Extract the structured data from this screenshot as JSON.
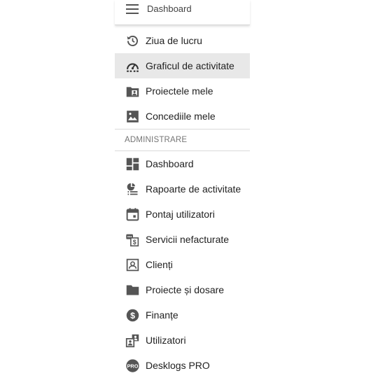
{
  "header": {
    "title": "Dashboard"
  },
  "menu_top": [
    {
      "label": "Ziua de lucru",
      "icon": "history-clock-icon",
      "active": false
    },
    {
      "label": "Graficul de activitate",
      "icon": "speedometer-icon",
      "active": true
    },
    {
      "label": "Proiectele mele",
      "icon": "folder-user-icon",
      "active": false
    },
    {
      "label": "Concediile mele",
      "icon": "image-landscape-icon",
      "active": false
    }
  ],
  "section": {
    "title": "ADMINISTRARE"
  },
  "menu_admin": [
    {
      "label": "Dashboard",
      "icon": "dashboard-tiles-icon"
    },
    {
      "label": "Rapoarte de activitate",
      "icon": "report-list-icon"
    },
    {
      "label": "Pontaj utilizatori",
      "icon": "calendar-icon"
    },
    {
      "label": "Servicii nefacturate",
      "icon": "unbilled-services-icon"
    },
    {
      "label": "Clienți",
      "icon": "contact-card-icon"
    },
    {
      "label": "Proiecte și dosare",
      "icon": "folder-icon"
    },
    {
      "label": "Finanțe",
      "icon": "dollar-circle-icon"
    },
    {
      "label": "Utilizatori",
      "icon": "users-icon"
    },
    {
      "label": "Desklogs PRO",
      "icon": "pro-badge-icon"
    }
  ],
  "colors": {
    "icon": "#555555",
    "active_bg": "#e8e8e8",
    "divider": "#d9d9d9"
  }
}
